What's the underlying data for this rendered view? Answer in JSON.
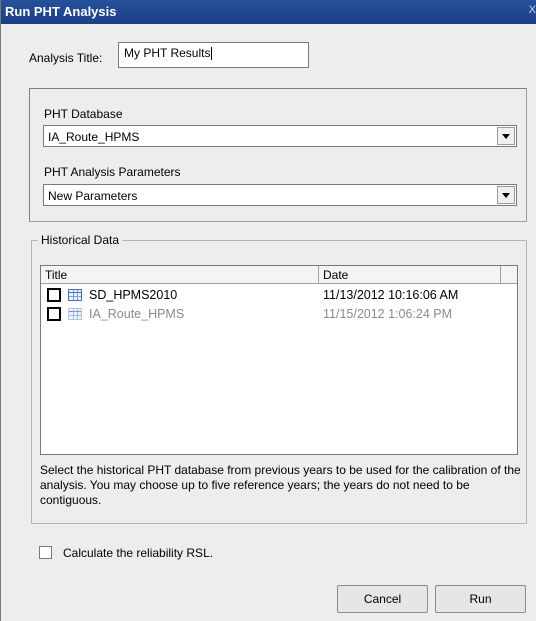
{
  "window": {
    "title": "Run PHT Analysis",
    "close_glyph": "X"
  },
  "analysis_title": {
    "label": "Analysis Title:",
    "value": "My PHT Results"
  },
  "database": {
    "label": "PHT Database",
    "selected": "IA_Route_HPMS"
  },
  "parameters": {
    "label": "PHT Analysis Parameters",
    "selected": "New Parameters"
  },
  "historical": {
    "legend": "Historical Data",
    "columns": [
      "Title",
      "Date"
    ],
    "rows": [
      {
        "title": "SD_HPMS2010",
        "date": "11/13/2012 10:16:06 AM",
        "checked": false,
        "enabled": true,
        "icon": "table-icon"
      },
      {
        "title": "IA_Route_HPMS",
        "date": "11/15/2012 1:06:24 PM",
        "checked": false,
        "enabled": false,
        "icon": "table-icon"
      }
    ],
    "help": "Select the historical PHT database from previous years to be used for the calibration of the analysis.  You may choose up to five reference years; the years do not need to be contiguous."
  },
  "reliability": {
    "label": "Calculate the reliability RSL.",
    "checked": false
  },
  "buttons": {
    "cancel": "Cancel",
    "run": "Run"
  }
}
